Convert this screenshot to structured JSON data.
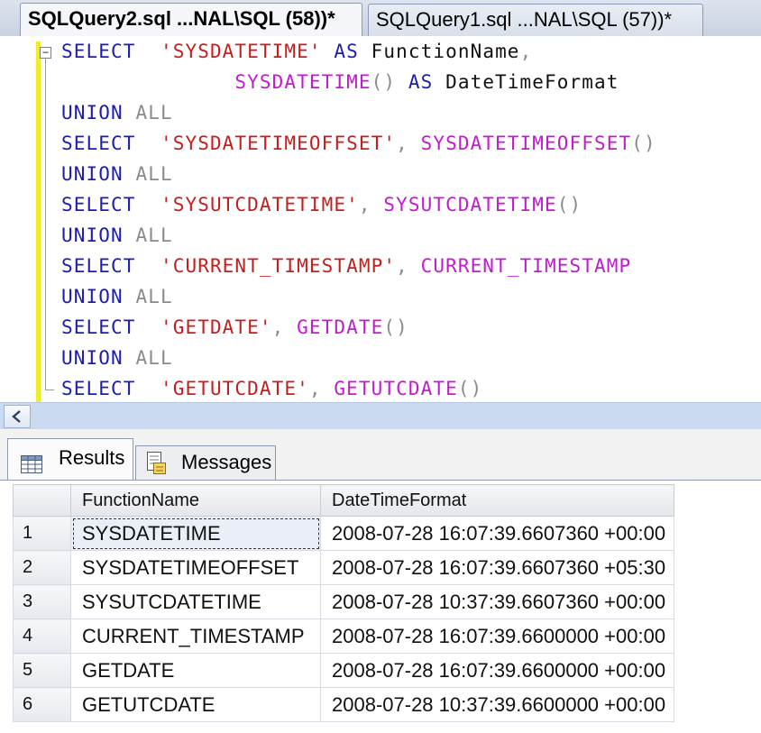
{
  "tabs": {
    "active": "SQLQuery2.sql ...NAL\\SQL (58))*",
    "inactive": "SQLQuery1.sql ...NAL\\SQL (57))*"
  },
  "editor": {
    "fold_glyph": "−",
    "lines": [
      [
        {
          "t": "SELECT",
          "c": "kw"
        },
        {
          "t": "  ",
          "c": "tx"
        },
        {
          "t": "'SYSDATETIME'",
          "c": "str"
        },
        {
          "t": " ",
          "c": "tx"
        },
        {
          "t": "AS",
          "c": "kw"
        },
        {
          "t": " FunctionName",
          "c": "tx"
        },
        {
          "t": ",",
          "c": "gr"
        }
      ],
      [
        {
          "t": "              ",
          "c": "tx"
        },
        {
          "t": "SYSDATETIME",
          "c": "fn"
        },
        {
          "t": "()",
          "c": "gr"
        },
        {
          "t": " ",
          "c": "tx"
        },
        {
          "t": "AS",
          "c": "kw"
        },
        {
          "t": " DateTimeFormat",
          "c": "tx"
        }
      ],
      [
        {
          "t": "UNION",
          "c": "kw"
        },
        {
          "t": " ",
          "c": "tx"
        },
        {
          "t": "ALL",
          "c": "gr"
        }
      ],
      [
        {
          "t": "SELECT",
          "c": "kw"
        },
        {
          "t": "  ",
          "c": "tx"
        },
        {
          "t": "'SYSDATETIMEOFFSET'",
          "c": "str"
        },
        {
          "t": ", ",
          "c": "gr"
        },
        {
          "t": "SYSDATETIMEOFFSET",
          "c": "fn"
        },
        {
          "t": "()",
          "c": "gr"
        }
      ],
      [
        {
          "t": "UNION",
          "c": "kw"
        },
        {
          "t": " ",
          "c": "tx"
        },
        {
          "t": "ALL",
          "c": "gr"
        }
      ],
      [
        {
          "t": "SELECT",
          "c": "kw"
        },
        {
          "t": "  ",
          "c": "tx"
        },
        {
          "t": "'SYSUTCDATETIME'",
          "c": "str"
        },
        {
          "t": ", ",
          "c": "gr"
        },
        {
          "t": "SYSUTCDATETIME",
          "c": "fn"
        },
        {
          "t": "()",
          "c": "gr"
        }
      ],
      [
        {
          "t": "UNION",
          "c": "kw"
        },
        {
          "t": " ",
          "c": "tx"
        },
        {
          "t": "ALL",
          "c": "gr"
        }
      ],
      [
        {
          "t": "SELECT",
          "c": "kw"
        },
        {
          "t": "  ",
          "c": "tx"
        },
        {
          "t": "'CURRENT_TIMESTAMP'",
          "c": "str"
        },
        {
          "t": ", ",
          "c": "gr"
        },
        {
          "t": "CURRENT_TIMESTAMP",
          "c": "fn"
        }
      ],
      [
        {
          "t": "UNION",
          "c": "kw"
        },
        {
          "t": " ",
          "c": "tx"
        },
        {
          "t": "ALL",
          "c": "gr"
        }
      ],
      [
        {
          "t": "SELECT",
          "c": "kw"
        },
        {
          "t": "  ",
          "c": "tx"
        },
        {
          "t": "'GETDATE'",
          "c": "str"
        },
        {
          "t": ", ",
          "c": "gr"
        },
        {
          "t": "GETDATE",
          "c": "fn"
        },
        {
          "t": "()",
          "c": "gr"
        }
      ],
      [
        {
          "t": "UNION",
          "c": "kw"
        },
        {
          "t": " ",
          "c": "tx"
        },
        {
          "t": "ALL",
          "c": "gr"
        }
      ],
      [
        {
          "t": "SELECT",
          "c": "kw"
        },
        {
          "t": "  ",
          "c": "tx"
        },
        {
          "t": "'GETUTCDATE'",
          "c": "str"
        },
        {
          "t": ", ",
          "c": "gr"
        },
        {
          "t": "GETUTCDATE",
          "c": "fn"
        },
        {
          "t": "()",
          "c": "gr"
        }
      ]
    ]
  },
  "colors": {
    "keyword": "#1c1cb4",
    "operator": "#8a8a8a",
    "string": "#c41e1e",
    "function": "#c21ad0",
    "change_bar": "#f0ec2a"
  },
  "scrollbar": {
    "left_arrow_icon": "chevron-left-icon"
  },
  "results_tabs": {
    "results": {
      "label": "Results",
      "icon": "grid-icon"
    },
    "messages": {
      "label": "Messages",
      "icon": "messages-icon"
    }
  },
  "grid": {
    "columns": [
      "FunctionName",
      "DateTimeFormat"
    ],
    "rows": [
      {
        "n": "1",
        "name": "SYSDATETIME",
        "value": "2008-07-28 16:07:39.6607360 +00:00"
      },
      {
        "n": "2",
        "name": "SYSDATETIMEOFFSET",
        "value": "2008-07-28 16:07:39.6607360 +05:30"
      },
      {
        "n": "3",
        "name": "SYSUTCDATETIME",
        "value": "2008-07-28 10:37:39.6607360 +00:00"
      },
      {
        "n": "4",
        "name": "CURRENT_TIMESTAMP",
        "value": "2008-07-28 16:07:39.6600000 +00:00"
      },
      {
        "n": "5",
        "name": "GETDATE",
        "value": "2008-07-28 16:07:39.6600000 +00:00"
      },
      {
        "n": "6",
        "name": "GETUTCDATE",
        "value": "2008-07-28 10:37:39.6600000 +00:00"
      }
    ]
  }
}
